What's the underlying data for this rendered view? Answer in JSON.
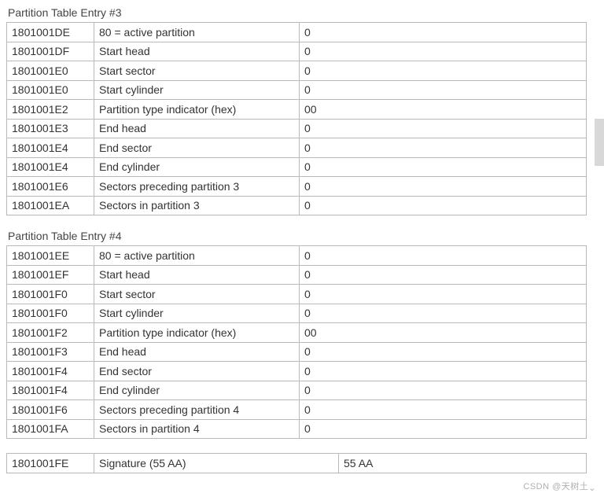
{
  "sections": [
    {
      "title": "Partition Table Entry #3",
      "rows": [
        {
          "offset": "1801001DE",
          "desc": "80 = active partition",
          "val": "0"
        },
        {
          "offset": "1801001DF",
          "desc": "Start head",
          "val": "0"
        },
        {
          "offset": "1801001E0",
          "desc": "Start sector",
          "val": "0"
        },
        {
          "offset": "1801001E0",
          "desc": "Start cylinder",
          "val": "0"
        },
        {
          "offset": "1801001E2",
          "desc": "Partition type indicator (hex)",
          "val": "00"
        },
        {
          "offset": "1801001E3",
          "desc": "End head",
          "val": "0"
        },
        {
          "offset": "1801001E4",
          "desc": "End sector",
          "val": "0"
        },
        {
          "offset": "1801001E4",
          "desc": "End cylinder",
          "val": "0"
        },
        {
          "offset": "1801001E6",
          "desc": "Sectors preceding partition 3",
          "val": "0"
        },
        {
          "offset": "1801001EA",
          "desc": "Sectors in partition 3",
          "val": "0"
        }
      ]
    },
    {
      "title": "Partition Table Entry #4",
      "rows": [
        {
          "offset": "1801001EE",
          "desc": "80 = active partition",
          "val": "0"
        },
        {
          "offset": "1801001EF",
          "desc": "Start head",
          "val": "0"
        },
        {
          "offset": "1801001F0",
          "desc": "Start sector",
          "val": "0"
        },
        {
          "offset": "1801001F0",
          "desc": "Start cylinder",
          "val": "0"
        },
        {
          "offset": "1801001F2",
          "desc": "Partition type indicator (hex)",
          "val": "00"
        },
        {
          "offset": "1801001F3",
          "desc": "End head",
          "val": "0"
        },
        {
          "offset": "1801001F4",
          "desc": "End sector",
          "val": "0"
        },
        {
          "offset": "1801001F4",
          "desc": "End cylinder",
          "val": "0"
        },
        {
          "offset": "1801001F6",
          "desc": "Sectors preceding partition 4",
          "val": "0"
        },
        {
          "offset": "1801001FA",
          "desc": "Sectors in partition 4",
          "val": "0"
        }
      ]
    },
    {
      "title": "",
      "rows": [
        {
          "offset": "1801001FE",
          "desc": "Signature (55 AA)",
          "val": "55 AA"
        }
      ]
    }
  ],
  "watermark": "CSDN @天树土"
}
